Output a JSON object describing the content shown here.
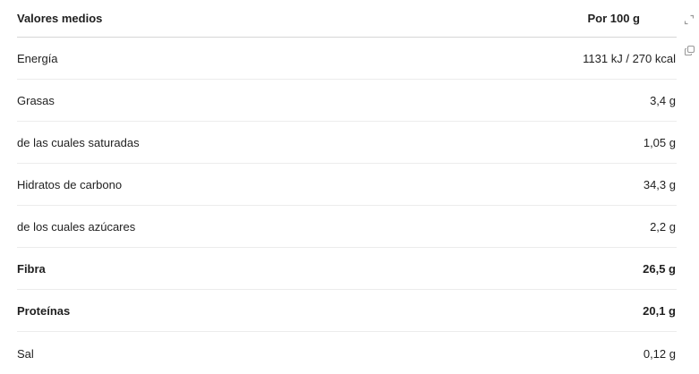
{
  "table": {
    "header": {
      "name": "Valores medios",
      "value": "Por 100 g"
    },
    "rows": [
      {
        "name": "Energía",
        "value": "1131 kJ / 270 kcal",
        "bold": false
      },
      {
        "name": "Grasas",
        "value": "3,4 g",
        "bold": false
      },
      {
        "name": "de las cuales saturadas",
        "value": "1,05 g",
        "bold": false
      },
      {
        "name": "Hidratos de carbono",
        "value": "34,3 g",
        "bold": false
      },
      {
        "name": "de los cuales azúcares",
        "value": "2,2 g",
        "bold": false
      },
      {
        "name": "Fibra",
        "value": "26,5 g",
        "bold": true
      },
      {
        "name": "Proteínas",
        "value": "20,1 g",
        "bold": true
      },
      {
        "name": "Sal",
        "value": "0,12 g",
        "bold": false
      }
    ]
  },
  "icons": {
    "expand": "expand-icon",
    "copy": "copy-icon"
  },
  "colors": {
    "text": "#1f1f1f",
    "divider": "#ececec",
    "header_divider": "#d6d6d6",
    "icon": "#9a9a9a"
  }
}
